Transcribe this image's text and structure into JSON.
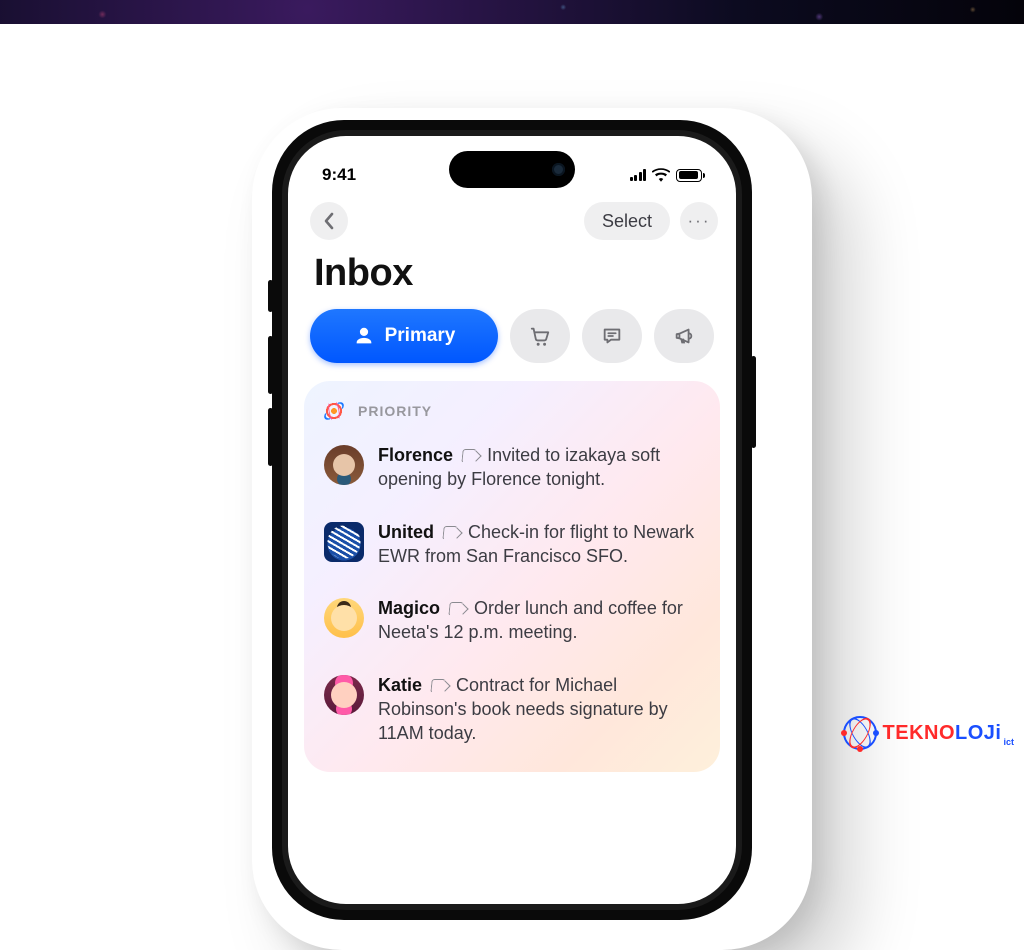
{
  "banner": {},
  "status": {
    "time": "9:41"
  },
  "nav": {
    "select_label": "Select",
    "more_label": "···"
  },
  "page_title": "Inbox",
  "tabs": {
    "primary_label": "Primary"
  },
  "priority": {
    "label": "PRIORITY",
    "items": [
      {
        "sender": "Florence",
        "avatar": "florence",
        "summary": "Invited to izakaya soft opening by Florence tonight."
      },
      {
        "sender": "United",
        "avatar": "united",
        "summary": "Check-in for flight to Newark EWR from San Francisco SFO."
      },
      {
        "sender": "Magico",
        "avatar": "magico",
        "summary": "Order lunch and coffee for Neeta's 12 p.m. meeting."
      },
      {
        "sender": "Katie",
        "avatar": "katie",
        "summary": "Contract for Michael Robinson's book needs signature by 11AM today."
      }
    ]
  },
  "watermark": {
    "brand_a": "TEKNO",
    "brand_b": "LOJi",
    "sub": "ict"
  }
}
